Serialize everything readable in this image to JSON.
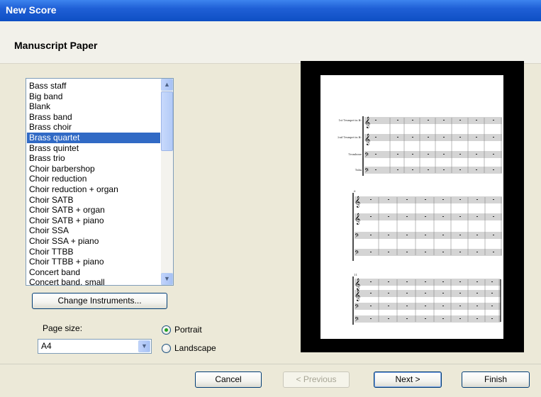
{
  "window": {
    "title": "New Score"
  },
  "page": {
    "heading": "Manuscript Paper"
  },
  "list": {
    "items": [
      "Bass staff",
      "Big band",
      "Blank",
      "Brass band",
      "Brass choir",
      "Brass quartet",
      "Brass quintet",
      "Brass trio",
      "Choir barbershop",
      "Choir reduction",
      "Choir reduction + organ",
      "Choir SATB",
      "Choir SATB + organ",
      "Choir SATB + piano",
      "Choir SSA",
      "Choir SSA + piano",
      "Choir TTBB",
      "Choir TTBB + piano",
      "Concert band",
      "Concert band, small"
    ],
    "selected": "Brass quartet",
    "selected_color": "#316ac5"
  },
  "change_instruments_label": "Change Instruments...",
  "page_size": {
    "label": "Page size:",
    "value": "A4"
  },
  "orientation": {
    "portrait_label": "Portrait",
    "landscape_label": "Landscape",
    "selected": "Portrait"
  },
  "preview": {
    "instrument_labels": [
      "1st Trumpet in B♭",
      "2nd Trumpet in B♭",
      "Trombone",
      "Tuba"
    ],
    "system_numbers": [
      "6",
      "11"
    ]
  },
  "buttons": {
    "cancel": "Cancel",
    "previous": "< Previous",
    "next": "Next >",
    "finish": "Finish"
  }
}
